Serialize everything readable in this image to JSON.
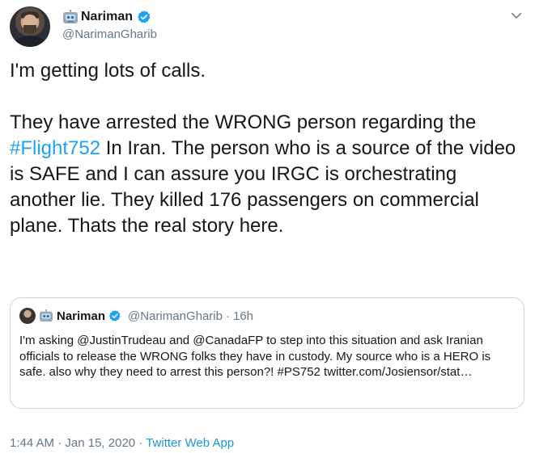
{
  "author": {
    "display_name": "Nariman",
    "handle": "@NarimanGharib"
  },
  "tweet": {
    "line1": "I'm getting lots of calls.",
    "para2_before": "They have arrested the WRONG person regarding the ",
    "hashtag": "#Flight752",
    "para2_after": " In Iran. The person who is a source of the video is SAFE and I can assure you IRGC is orchestrating another lie. They killed 176 passengers on commercial plane. Thats the real story here."
  },
  "quoted": {
    "display_name": "Nariman",
    "handle": "@NarimanGharib",
    "separator": " · ",
    "time": "16h",
    "text": "I'm asking  @JustinTrudeau  and @CanadaFP  to step into this situation and ask Iranian officials to release the WRONG folks they have in custody. My source who is a HERO is safe. also why they need to arrest this person?! #PS752 twitter.com/Josiensor/stat…"
  },
  "footer": {
    "time": "1:44 AM",
    "sep1": " · ",
    "date": "Jan 15, 2020",
    "sep2": " · ",
    "app": "Twitter Web App"
  },
  "colors": {
    "link": "#1da1f2",
    "secondary_text": "#657786",
    "border": "#ccd6dd"
  },
  "icons": {
    "robot": "robot-emoji-icon",
    "verified": "verified-badge-icon",
    "caret": "chevron-down-icon"
  }
}
